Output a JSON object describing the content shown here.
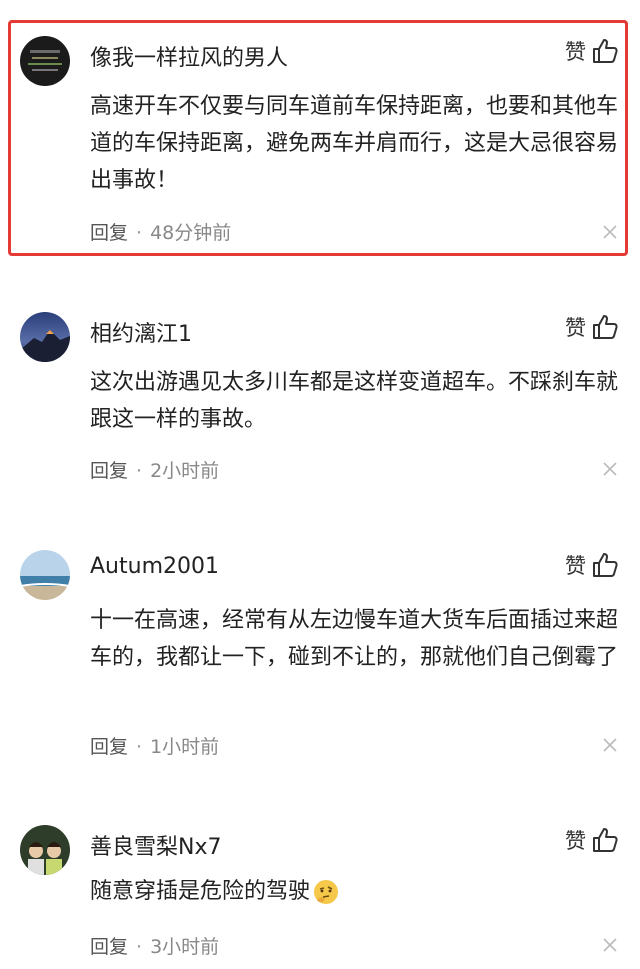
{
  "comments": [
    {
      "username": "像我一样拉风的男人",
      "like_label": "赞",
      "content": "高速开车不仅要与同车道前车保持距离，也要和其他车道的车保持距离，避免两车并肩而行，这是大忌很容易出事故！",
      "reply_label": "回复",
      "separator": "·",
      "time": "48分钟前",
      "highlighted": true
    },
    {
      "username": "相约漓江1",
      "like_label": "赞",
      "content": "这次出游遇见太多川车都是这样变道超车。不踩刹车就跟这一样的事故。",
      "reply_label": "回复",
      "separator": "·",
      "time": "2小时前"
    },
    {
      "username": "Autum2001",
      "like_label": "赞",
      "content": "十一在高速，经常有从左边慢车道大货车后面插过来超车的，我都让一下，碰到不让的，那就他们自己倒霉了",
      "reply_label": "回复",
      "separator": "·",
      "time": "1小时前"
    },
    {
      "username": "善良雪梨Nx7",
      "like_label": "赞",
      "content": "随意穿插是危险的驾驶",
      "emoji": "thinking-face-icon",
      "reply_label": "回复",
      "separator": "·",
      "time": "3小时前"
    }
  ],
  "colors": {
    "highlight_border": "#e53935",
    "meta_text": "#888888"
  }
}
